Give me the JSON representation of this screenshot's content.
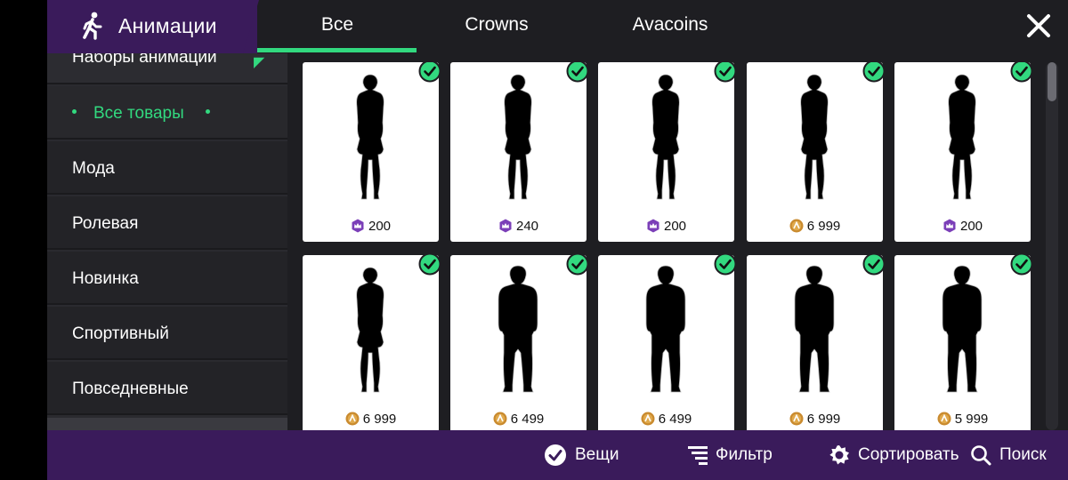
{
  "header": {
    "title": "Анимации",
    "tabs": [
      {
        "label": "Все",
        "active": true
      },
      {
        "label": "Crowns",
        "active": false
      },
      {
        "label": "Avacoins",
        "active": false
      }
    ]
  },
  "sidebar": {
    "section_title": "Наборы анимации",
    "items": [
      {
        "label": "Все товары",
        "active": true
      },
      {
        "label": "Мода",
        "active": false
      },
      {
        "label": "Ролевая",
        "active": false
      },
      {
        "label": "Новинка",
        "active": false
      },
      {
        "label": "Спортивный",
        "active": false
      },
      {
        "label": "Повседневные",
        "active": false
      }
    ]
  },
  "items": [
    {
      "price": "200",
      "currency": "crowns",
      "owned": true,
      "pose": "female-hand-head"
    },
    {
      "price": "240",
      "currency": "crowns",
      "owned": true,
      "pose": "female-standing"
    },
    {
      "price": "200",
      "currency": "crowns",
      "owned": true,
      "pose": "female-heart-hands"
    },
    {
      "price": "6 999",
      "currency": "avacoins",
      "owned": true,
      "pose": "female-hands-chest"
    },
    {
      "price": "200",
      "currency": "crowns",
      "owned": true,
      "pose": "female-hip-wave"
    },
    {
      "price": "6 999",
      "currency": "avacoins",
      "owned": true,
      "pose": "female-dance"
    },
    {
      "price": "6 499",
      "currency": "avacoins",
      "owned": true,
      "pose": "male-crouch-dance"
    },
    {
      "price": "6 499",
      "currency": "avacoins",
      "owned": true,
      "pose": "male-standing"
    },
    {
      "price": "6 999",
      "currency": "avacoins",
      "owned": true,
      "pose": "male-hands-together"
    },
    {
      "price": "5 999",
      "currency": "avacoins",
      "owned": true,
      "pose": "male-arms-crossed"
    }
  ],
  "footer": {
    "items_label": "Вещи",
    "filter_label": "Фильтр",
    "sort_label": "Сортировать",
    "search_label": "Поиск"
  },
  "colors": {
    "accent": "#32d97f",
    "brand_purple": "#3a1b5b",
    "crown_purple": "#7b3fb8",
    "coin_gold": "#c98a2e"
  },
  "icons": {
    "title": "walking-person-icon",
    "close": "close-icon",
    "owned": "check-circle-icon",
    "crowns": "crown-currency-icon",
    "avacoins": "avacoin-icon",
    "items": "check-circle-icon",
    "filter": "filter-icon",
    "sort": "sort-gear-icon",
    "search": "search-icon"
  }
}
